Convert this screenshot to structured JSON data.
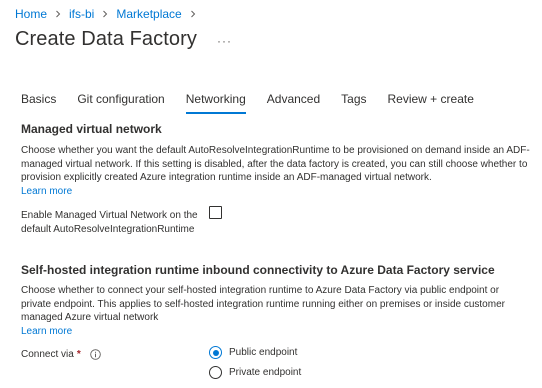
{
  "breadcrumb": {
    "items": [
      "Home",
      "ifs-bi",
      "Marketplace"
    ]
  },
  "page": {
    "title": "Create Data Factory",
    "more_label": "···"
  },
  "tabs": [
    {
      "label": "Basics",
      "active": false
    },
    {
      "label": "Git configuration",
      "active": false
    },
    {
      "label": "Networking",
      "active": true
    },
    {
      "label": "Advanced",
      "active": false
    },
    {
      "label": "Tags",
      "active": false
    },
    {
      "label": "Review + create",
      "active": false
    }
  ],
  "managed_vnet": {
    "title": "Managed virtual network",
    "description": "Choose whether you want the default AutoResolveIntegrationRuntime to be provisioned on demand inside an ADF-managed virtual network. If this setting is disabled, after the data factory is created, you can still choose whether to provision explicitly created Azure integration runtime inside an ADF-managed virtual network.",
    "learn_more": "Learn more",
    "checkbox_label": "Enable Managed Virtual Network on the default AutoResolveIntegrationRuntime",
    "checked": false
  },
  "self_hosted": {
    "title": "Self-hosted integration runtime inbound connectivity to Azure Data Factory service",
    "description": "Choose whether to connect your self-hosted integration runtime to Azure Data Factory via public endpoint or private endpoint. This applies to self-hosted integration runtime running either on premises or inside customer managed Azure virtual network",
    "learn_more": "Learn more",
    "connect_label": "Connect via",
    "required_mark": "*",
    "options": [
      {
        "label": "Public endpoint",
        "selected": true
      },
      {
        "label": "Private endpoint",
        "selected": false
      }
    ]
  },
  "colors": {
    "accent": "#0078d4",
    "text": "#323130",
    "required": "#a4262c"
  },
  "icons": {
    "breadcrumb_separator": "chevron-right-icon",
    "info": "info-icon"
  }
}
